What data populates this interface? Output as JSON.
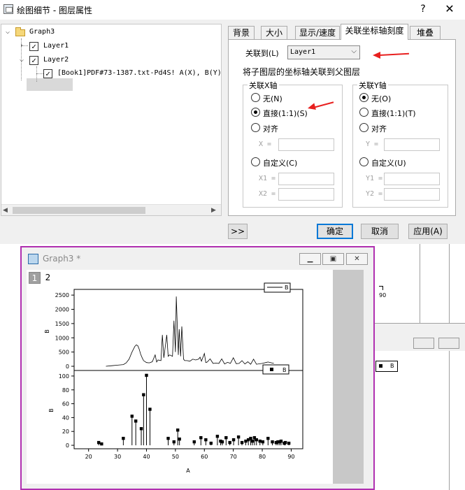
{
  "dialog": {
    "title": "绘图细节 - 图层属性",
    "help": "?",
    "close": "✕",
    "tree": {
      "root": "Graph3",
      "layer1": "Layer1",
      "layer2": "Layer2",
      "dataset": "[Book1]PDF#73-1387.txt-Pd4S! A(X), B(Y)"
    },
    "tabs": [
      "背景",
      "大小",
      "显示/速度",
      "关联坐标轴刻度",
      "堆叠"
    ],
    "active_tab_index": 3,
    "link_to_label": "关联到(L)",
    "link_to_value": "Layer1",
    "link_desc": "将子图层的坐标轴关联到父图层",
    "x_group": {
      "title": "关联X轴",
      "opt_none": "无(N)",
      "opt_direct": "直接(1:1)(S)",
      "opt_align": "对齐",
      "align_field": "X =",
      "opt_custom": "自定义(C)",
      "x1": "X1 =",
      "x2": "X2 =",
      "selected": "direct"
    },
    "y_group": {
      "title": "关联Y轴",
      "opt_none": "无(O)",
      "opt_direct": "直接(1:1)(T)",
      "opt_align": "对齐",
      "align_field": "Y =",
      "opt_custom": "自定义(U)",
      "y1": "Y1 =",
      "y2": "Y2 =",
      "selected": "none"
    },
    "buttons": {
      "expand": ">>",
      "ok": "确定",
      "cancel": "取消",
      "apply": "应用(A)"
    }
  },
  "background": {
    "tick_label": "90",
    "legend": "B"
  },
  "graph_window": {
    "title": "Graph3 *",
    "layer_tabs": [
      "1",
      "2"
    ],
    "layer1": {
      "legend": "B",
      "ylabel": "B",
      "yticks": [
        "2500",
        "2000",
        "1500",
        "1000",
        "500",
        "0"
      ]
    },
    "layer2": {
      "legend": "B",
      "ylabel": "B",
      "yticks": [
        "100",
        "80",
        "60",
        "40",
        "20",
        "0"
      ],
      "xticks": [
        "20",
        "30",
        "40",
        "50",
        "60",
        "70",
        "80",
        "90"
      ],
      "xlabel": "A"
    }
  },
  "chart_data": [
    {
      "type": "line",
      "series": [
        {
          "name": "B",
          "x": [
            26,
            28,
            30,
            32,
            33,
            34,
            35,
            36,
            36.5,
            37,
            37.5,
            38,
            38.5,
            39,
            40,
            41,
            42,
            43,
            43.5,
            44,
            45,
            45.5,
            46,
            46.5,
            47,
            47.5,
            48,
            49,
            49.5,
            50,
            50.3,
            51,
            51.3,
            51.8,
            52.2,
            52.8,
            53.2,
            54,
            55,
            56,
            57,
            58,
            58.5,
            59,
            60,
            60.5,
            61,
            62,
            63,
            64,
            65,
            66,
            67,
            68,
            69,
            70,
            71,
            72,
            73,
            74,
            75,
            76,
            77,
            78,
            80,
            82,
            84
          ],
          "y": [
            0,
            20,
            40,
            60,
            120,
            250,
            500,
            700,
            750,
            720,
            600,
            420,
            300,
            200,
            130,
            120,
            160,
            400,
            150,
            220,
            200,
            1100,
            300,
            700,
            1100,
            350,
            400,
            350,
            1600,
            500,
            2450,
            400,
            1300,
            350,
            1400,
            250,
            200,
            200,
            180,
            250,
            220,
            250,
            320,
            180,
            450,
            130,
            150,
            260,
            100,
            110,
            100,
            260,
            80,
            140,
            100,
            300,
            90,
            100,
            200,
            80,
            160,
            70,
            250,
            70,
            100,
            150,
            100
          ]
        }
      ],
      "ylim": [
        0,
        2700
      ],
      "xlim": [
        15,
        94
      ]
    },
    {
      "type": "scatter",
      "series": [
        {
          "name": "B",
          "x": [
            23.5,
            24.5,
            32,
            35,
            36.3,
            38.2,
            39,
            40,
            41.2,
            47.5,
            49.5,
            50.8,
            51.4,
            56.5,
            58.8,
            60.5,
            62.3,
            64.5,
            65.6,
            66.2,
            67.5,
            68.8,
            70.1,
            71.8,
            73,
            74.3,
            75.2,
            76,
            76.6,
            77.3,
            78,
            79.2,
            80.2,
            82,
            83.5,
            84.8,
            85.4,
            86,
            86.5,
            87.6,
            88,
            89.2
          ],
          "y": [
            4,
            2,
            10,
            42,
            35,
            24,
            73,
            101,
            52,
            10,
            5,
            22,
            9,
            5,
            11,
            8,
            3,
            13,
            6,
            5,
            11,
            4,
            8,
            12,
            4,
            6,
            8,
            10,
            6,
            11,
            8,
            6,
            5,
            10,
            5,
            4,
            5,
            5,
            6,
            3,
            4,
            3
          ]
        }
      ],
      "ylim": [
        -5,
        108
      ],
      "xlim": [
        15,
        94
      ],
      "xlabel": "A"
    }
  ]
}
